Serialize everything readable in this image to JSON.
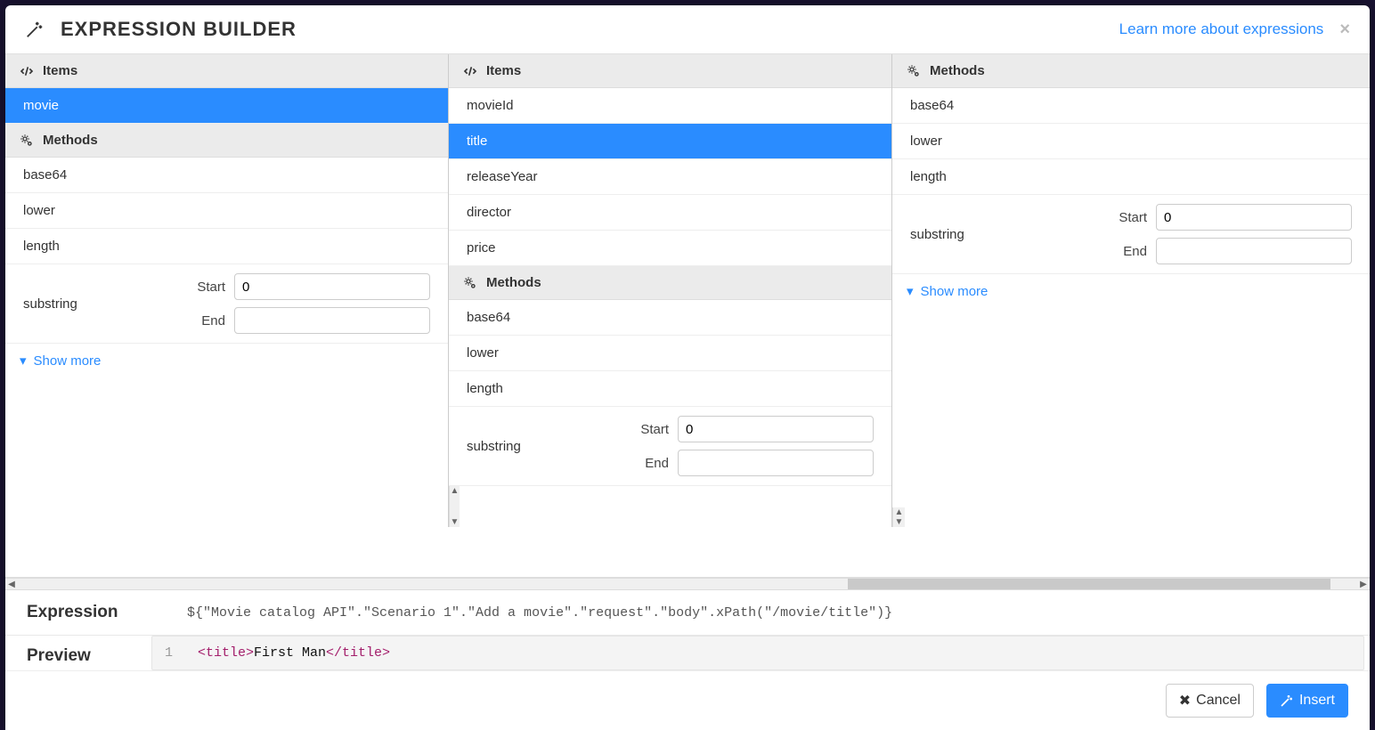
{
  "header": {
    "title": "EXPRESSION BUILDER",
    "learn_more": "Learn more about expressions"
  },
  "col1": {
    "items_header": "Items",
    "items": [
      {
        "label": "movie",
        "selected": true
      }
    ],
    "methods_header": "Methods",
    "methods": [
      "base64",
      "lower",
      "length"
    ],
    "substring_label": "substring",
    "start_label": "Start",
    "end_label": "End",
    "start_value": "0",
    "end_value": "",
    "show_more": "Show more"
  },
  "col2": {
    "items_header": "Items",
    "items": [
      {
        "label": "movieId",
        "selected": false
      },
      {
        "label": "title",
        "selected": true
      },
      {
        "label": "releaseYear",
        "selected": false
      },
      {
        "label": "director",
        "selected": false
      },
      {
        "label": "price",
        "selected": false
      }
    ],
    "methods_header": "Methods",
    "methods": [
      "base64",
      "lower",
      "length"
    ],
    "substring_label": "substring",
    "start_label": "Start",
    "end_label": "End",
    "start_value": "0",
    "end_value": ""
  },
  "col3": {
    "methods_header": "Methods",
    "methods": [
      "base64",
      "lower",
      "length"
    ],
    "substring_label": "substring",
    "start_label": "Start",
    "end_label": "End",
    "start_value": "0",
    "end_value": "",
    "show_more": "Show more"
  },
  "expression": {
    "label": "Expression",
    "code": "${\"Movie catalog API\".\"Scenario 1\".\"Add a movie\".\"request\".\"body\".xPath(\"/movie/title\")}"
  },
  "preview": {
    "label": "Preview",
    "line_no": "1",
    "open_tag": "<title>",
    "value": " First Man ",
    "close_tag": "</title>"
  },
  "footer": {
    "cancel": "Cancel",
    "insert": "Insert"
  }
}
